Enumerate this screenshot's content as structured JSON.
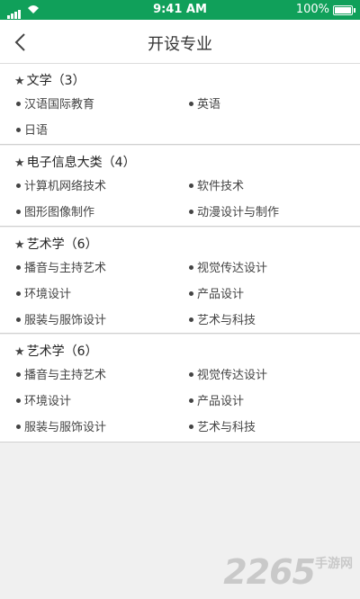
{
  "status_bar": {
    "time": "9:41 AM",
    "battery": "100%"
  },
  "nav": {
    "title": "开设专业"
  },
  "sections": [
    {
      "title": "文学（3）",
      "majors": [
        "汉语国际教育",
        "英语",
        "日语"
      ]
    },
    {
      "title": "电子信息大类（4）",
      "majors": [
        "计算机网络技术",
        "软件技术",
        "图形图像制作",
        "动漫设计与制作"
      ]
    },
    {
      "title": "艺术学（6）",
      "majors": [
        "播音与主持艺术",
        "视觉传达设计",
        "环境设计",
        "产品设计",
        "服装与服饰设计",
        "艺术与科技"
      ]
    },
    {
      "title": "艺术学（6）",
      "majors": [
        "播音与主持艺术",
        "视觉传达设计",
        "环境设计",
        "产品设计",
        "服装与服饰设计",
        "艺术与科技"
      ]
    }
  ],
  "watermark": {
    "number": "2265",
    "text": "手游网"
  },
  "icons": {
    "star": "star-icon",
    "bullet": "dot-icon",
    "back": "chevron-left-icon"
  },
  "colors": {
    "status_bar": "#10a05a"
  }
}
